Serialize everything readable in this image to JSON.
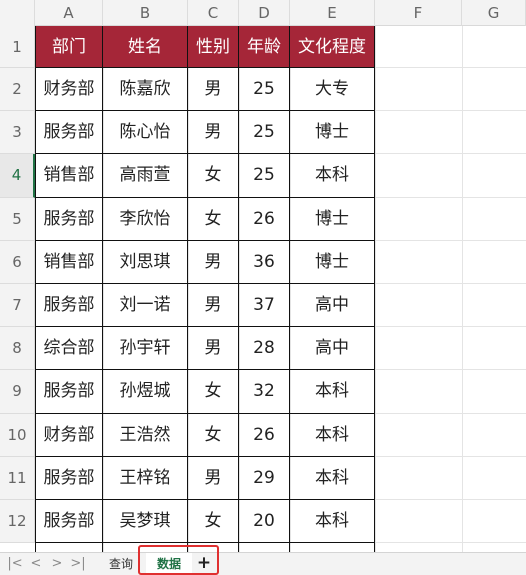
{
  "columns": [
    "A",
    "B",
    "C",
    "D",
    "E",
    "F",
    "G"
  ],
  "rows": [
    "1",
    "2",
    "3",
    "4",
    "5",
    "6",
    "7",
    "8",
    "9",
    "10",
    "11",
    "12"
  ],
  "active_row": "4",
  "table": {
    "headers": [
      "部门",
      "姓名",
      "性别",
      "年龄",
      "文化程度"
    ],
    "data": [
      [
        "财务部",
        "陈嘉欣",
        "男",
        "25",
        "大专"
      ],
      [
        "服务部",
        "陈心怡",
        "男",
        "25",
        "博士"
      ],
      [
        "销售部",
        "高雨萱",
        "女",
        "25",
        "本科"
      ],
      [
        "服务部",
        "李欣怡",
        "女",
        "26",
        "博士"
      ],
      [
        "销售部",
        "刘思琪",
        "男",
        "36",
        "博士"
      ],
      [
        "服务部",
        "刘一诺",
        "男",
        "37",
        "高中"
      ],
      [
        "综合部",
        "孙宇轩",
        "男",
        "28",
        "高中"
      ],
      [
        "服务部",
        "孙煜城",
        "女",
        "32",
        "本科"
      ],
      [
        "财务部",
        "王浩然",
        "女",
        "26",
        "本科"
      ],
      [
        "服务部",
        "王梓铭",
        "男",
        "29",
        "本科"
      ],
      [
        "服务部",
        "吴梦琪",
        "女",
        "20",
        "本科"
      ]
    ]
  },
  "sheet_tabs": [
    "查询",
    "数据"
  ],
  "active_tab": "数据",
  "add_sheet_label": "+",
  "nav_icons": [
    "first-sheet-icon",
    "prev-sheet-icon",
    "next-sheet-icon",
    "last-sheet-icon"
  ],
  "colors": {
    "header_fill": "#a52638",
    "accent": "#217346",
    "highlight": "#e03030"
  }
}
